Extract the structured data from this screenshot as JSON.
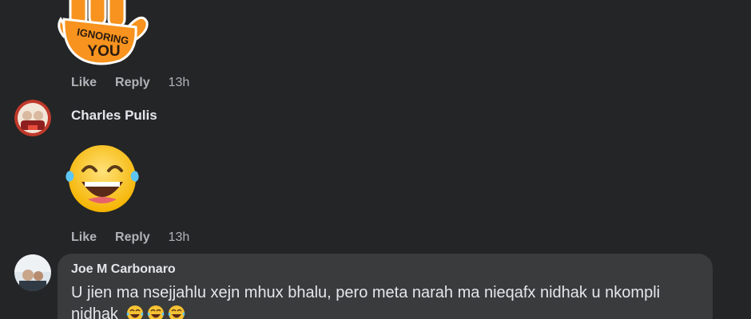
{
  "comments": [
    {
      "sticker": "ignoring-you-hand-sticker",
      "sticker_text_line1": "IGNORING",
      "sticker_text_line2": "YOU",
      "actions": {
        "like": "Like",
        "reply": "Reply",
        "time": "13h"
      }
    },
    {
      "author": "Charles Pulis",
      "avatar": "avatar-photo",
      "sticker": "laughing-tears-emoji",
      "actions": {
        "like": "Like",
        "reply": "Reply",
        "time": "13h"
      }
    },
    {
      "author": "Joe M Carbonaro",
      "avatar": "avatar-photo",
      "text": "U jien ma nsejjahlu xejn mhux bhalu, pero meta narah ma nieqafx nidhak u nkompli nidhak",
      "emojis": [
        "laughing-tears-emoji",
        "laughing-tears-emoji",
        "laughing-tears-emoji"
      ]
    }
  ],
  "colors": {
    "background": "#242526",
    "bubble": "#3a3b3c",
    "text_primary": "#e4e6eb",
    "text_secondary": "#b0b3b8",
    "sticker_orange": "#f7931e"
  }
}
